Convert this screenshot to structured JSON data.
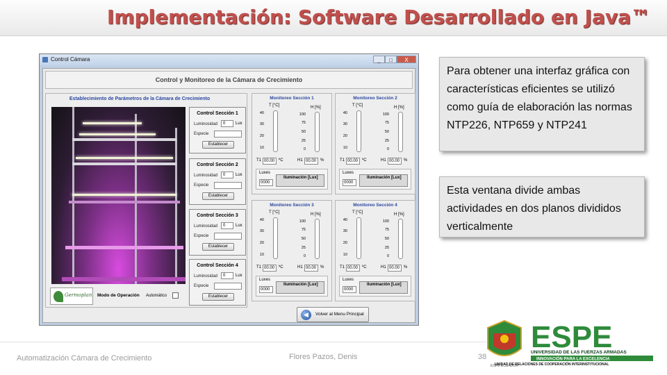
{
  "slide": {
    "title": "Implementación: Software Desarrollado en Java™",
    "footer_left": "Automatización Cámara de Crecimiento",
    "footer_center": "Flores Pazos, Denis",
    "slide_number": "38",
    "text_box_1": "Para obtener una interfaz gráfica con características eficientes se utilizó como guía de elaboración las normas NTP226, NTP659 y NTP241",
    "text_box_2": "Esta ventana divide ambas actividades en dos planos divididos verticalmente"
  },
  "window": {
    "title": "Control Cámara",
    "controls": [
      "_",
      "□",
      "X"
    ],
    "header": "Control y Monitoreo de la Cámara de Crecimiento",
    "left_panel_title": "Establecimiento de Parámetros de la Cámara de Crecimiento",
    "sections": [
      {
        "title": "Control Sección 1",
        "lum_label": "Luminosidad",
        "lum_value": "0",
        "lum_unit": "Lux",
        "species_label": "Especie",
        "button": "Establecer"
      },
      {
        "title": "Control Sección 2",
        "lum_label": "Luminosidad",
        "lum_value": "0",
        "lum_unit": "Lux",
        "species_label": "Especie",
        "button": "Establecer"
      },
      {
        "title": "Control Sección 3",
        "lum_label": "Luminosidad",
        "lum_value": "0",
        "lum_unit": "Lux",
        "species_label": "Especie",
        "button": "Establecer"
      },
      {
        "title": "Control Sección 4",
        "lum_label": "Luminosidad",
        "lum_value": "0",
        "lum_unit": "Lux",
        "species_label": "Especie",
        "button": "Establecer"
      }
    ],
    "mode_label": "Modo de Operación",
    "mode_value": "Automático",
    "monitors": [
      {
        "title": "Monitoreo Sección 1",
        "t_label": "T [°C]",
        "h_label": "H [%]",
        "t_ticks": [
          "40",
          "30",
          "20",
          "10"
        ],
        "h_ticks": [
          "100",
          "75",
          "50",
          "25",
          "0"
        ],
        "t1_label": "T1",
        "t1_value": "00.00",
        "t_unit": "ºC",
        "h1_label": "H1",
        "h1_value": "00.00",
        "h_unit": "%",
        "luxes_label": "Luxes",
        "luxes_value": "0000",
        "illum_label": "Iluminación [Lux]"
      },
      {
        "title": "Monitoreo Sección 2",
        "t_label": "T [°C]",
        "h_label": "H [%]",
        "t_ticks": [
          "40",
          "30",
          "20",
          "10"
        ],
        "h_ticks": [
          "100",
          "75",
          "50",
          "25",
          "0"
        ],
        "t1_label": "T1",
        "t1_value": "00.00",
        "t_unit": "ºC",
        "h1_label": "H1",
        "h1_value": "00.00",
        "h_unit": "%",
        "luxes_label": "Luxes",
        "luxes_value": "0000",
        "illum_label": "Iluminación [Lux]"
      },
      {
        "title": "Monitoreo Sección 3",
        "t_label": "T [°C]",
        "h_label": "H [%]",
        "t_ticks": [
          "40",
          "30",
          "20",
          "10"
        ],
        "h_ticks": [
          "100",
          "75",
          "50",
          "25",
          "0"
        ],
        "t1_label": "T1",
        "t1_value": "00.00",
        "t_unit": "ºC",
        "h1_label": "H1",
        "h1_value": "00.00",
        "h_unit": "%",
        "luxes_label": "Luxes",
        "luxes_value": "0000",
        "illum_label": "Iluminación [Lux]"
      },
      {
        "title": "Monitoreo Sección 4",
        "t_label": "T [°C]",
        "h_label": "H [%]",
        "t_ticks": [
          "40",
          "30",
          "20",
          "10"
        ],
        "h_ticks": [
          "100",
          "75",
          "50",
          "25",
          "0"
        ],
        "t1_label": "T1",
        "t1_value": "00.00",
        "t_unit": "ºC",
        "h1_label": "H1",
        "h1_value": "00.00",
        "h_unit": "%",
        "luxes_label": "Luxes",
        "luxes_value": "0000",
        "illum_label": "Iluminación [Lux]"
      }
    ],
    "back_button": "Volver al Menu Principal",
    "logo_text": "Germoplanta"
  },
  "espe": {
    "name": "ESPE",
    "line1": "UNIVERSIDAD DE LAS FUERZAS ARMADAS",
    "line2": "INNOVACIÓN PARA LA EXCELENCIA",
    "line3": "UNIDAD DE RELACIONES DE COOPERACIÓN INTERINSTITUCIONAL",
    "crest_label": "ESPE ECUADOR"
  },
  "colors": {
    "title_red": "#c0504d",
    "espe_green": "#2e8b3a",
    "espe_dark": "#0b3b1a",
    "panel_blue": "#2a46a0"
  }
}
